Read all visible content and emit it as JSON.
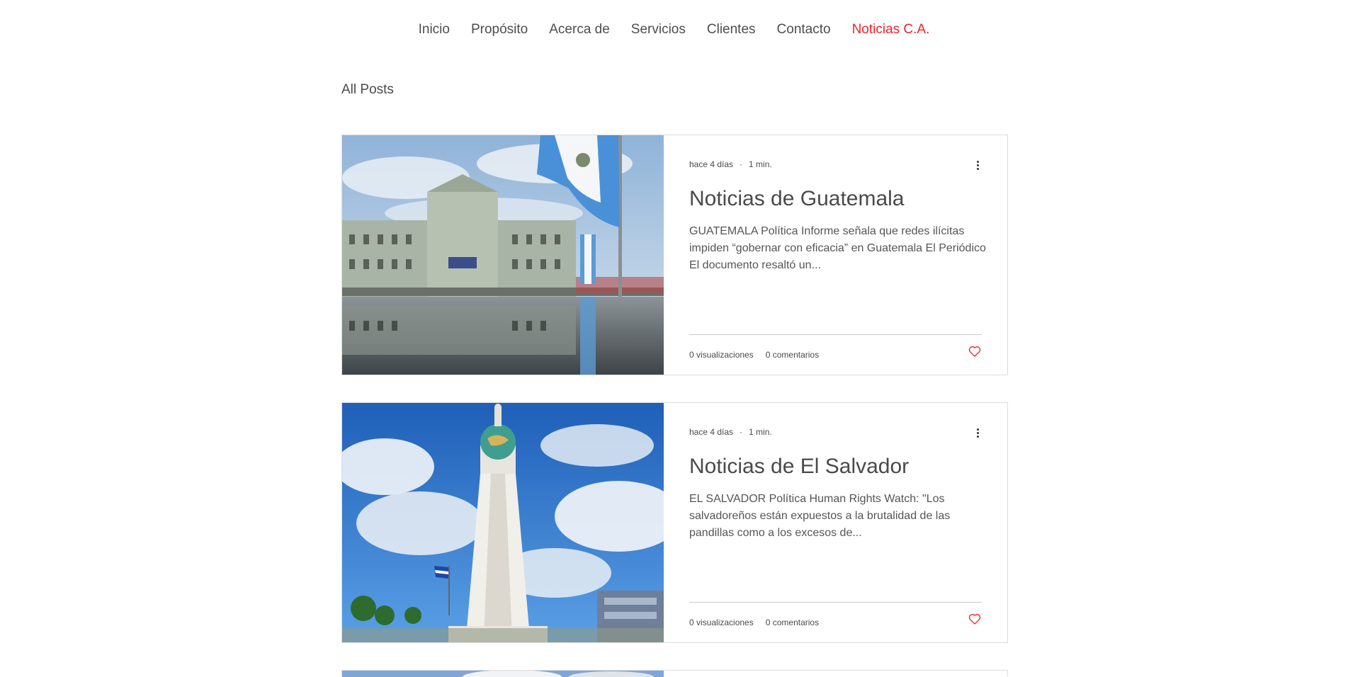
{
  "nav": {
    "items": [
      {
        "label": "Inicio"
      },
      {
        "label": "Propósito"
      },
      {
        "label": "Acerca de"
      },
      {
        "label": "Servicios"
      },
      {
        "label": "Clientes"
      },
      {
        "label": "Contacto"
      },
      {
        "label": "Noticias C.A."
      }
    ],
    "active_color": "#e8242b"
  },
  "page_title": "All Posts",
  "posts": [
    {
      "date": "hace 4 días",
      "read_time": "1 min.",
      "title": "Noticias de Guatemala",
      "excerpt": "GUATEMALA Política Informe señala que redes ilícitas impiden “gobernar con eficacia” en Guatemala El Periódico El documento resaltó un...",
      "views": "0 visualizaciones",
      "comments": "0 comentarios",
      "image_icon": "national-palace-guatemala-image"
    },
    {
      "date": "hace 4 días",
      "read_time": "1 min.",
      "title": "Noticias de El Salvador",
      "excerpt": "EL SALVADOR Política Human Rights Watch: \"Los salvadoreños están expuestos a la brutalidad de las pandillas como a los excesos de...",
      "views": "0 visualizaciones",
      "comments": "0 comentarios",
      "image_icon": "salvador-del-mundo-monument-image"
    }
  ],
  "icons": {
    "more": "more-vertical-icon",
    "like": "heart-icon"
  },
  "colors": {
    "like": "#e8242b",
    "text": "#4a4a4a"
  }
}
